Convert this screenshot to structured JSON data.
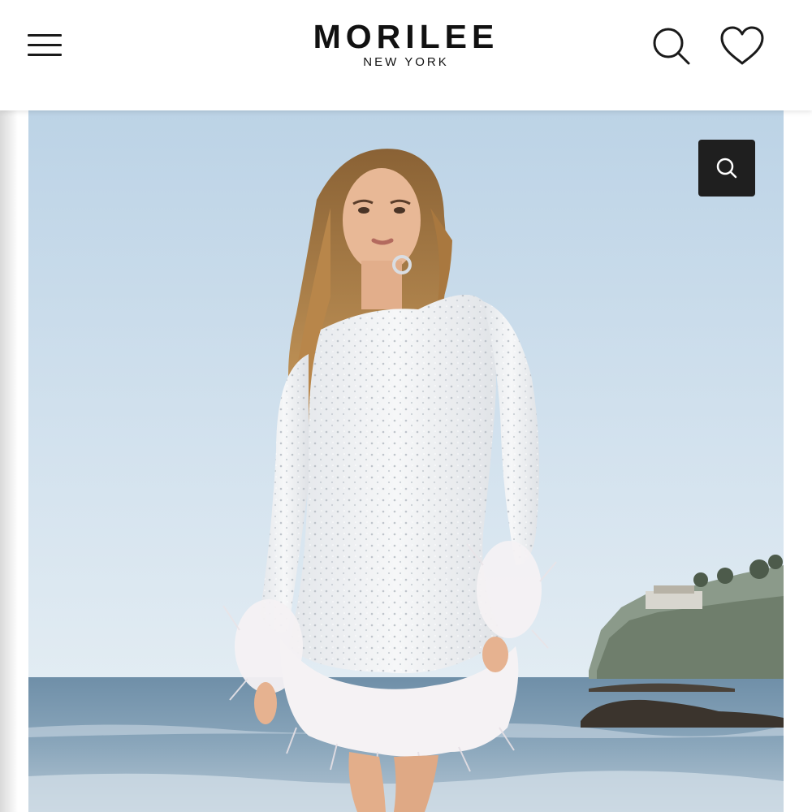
{
  "header": {
    "brand_name": "MORILEE",
    "brand_location": "NEW YORK",
    "menu_icon": "hamburger-menu-icon",
    "search_icon": "search-icon",
    "wishlist_icon": "heart-icon"
  },
  "hero": {
    "image_subject": "model in white long-sleeve sequin mini dress with feather trim on a beach",
    "zoom_icon": "zoom-search-icon"
  },
  "colors": {
    "header_bg": "#ffffff",
    "text": "#111111",
    "zoom_button_bg": "#1f1f1f",
    "sky": "#cfe0ec",
    "sea": "#7f9db3"
  }
}
